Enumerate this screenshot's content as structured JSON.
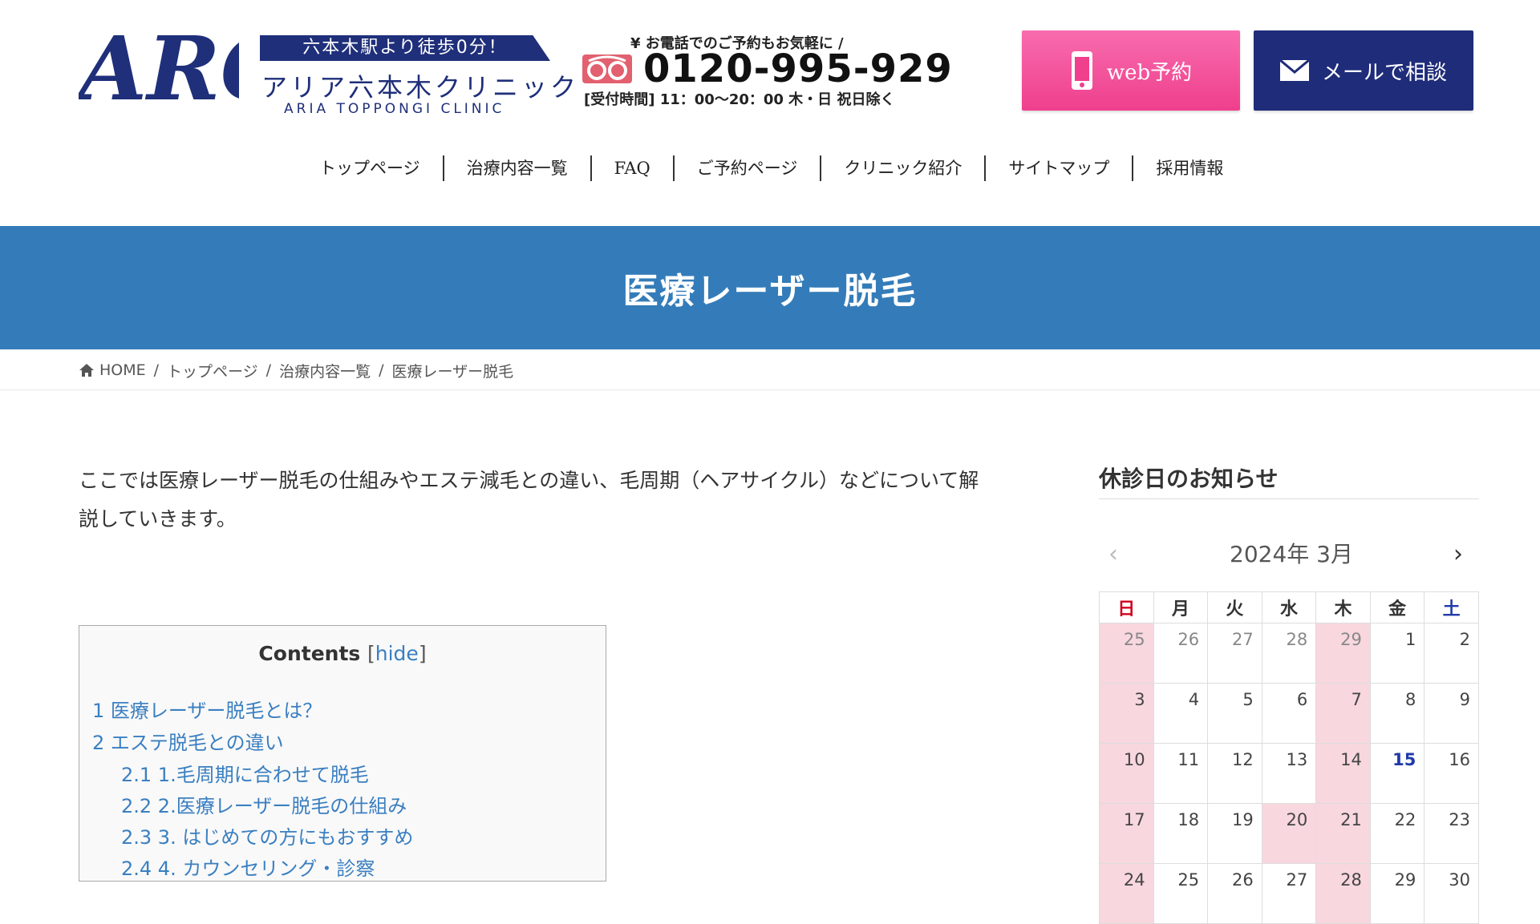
{
  "header": {
    "logo_text": "ARC",
    "badge": "六本木駅より徒歩0分！",
    "clinic_name": "アリア六本木クリニック",
    "clinic_name_en": "ARIA TOPPONGI CLINIC",
    "tel_lead": "¥ お電話でのご予約もお気軽に /",
    "tel_number": "0120-995-929",
    "tel_hours": "[受付時間] 11：00〜20：00 木・日 祝日除く",
    "web_button": "web予約",
    "mail_button": "メールで相談",
    "colors": {
      "web": "#ef3f8d",
      "mail": "#1f2c7a",
      "brand": "#1f2f7a"
    }
  },
  "nav": {
    "items": [
      "トップページ",
      "治療内容一覧",
      "FAQ",
      "ご予約ページ",
      "クリニック紹介",
      "サイトマップ",
      "採用情報"
    ]
  },
  "hero": {
    "title": "医療レーザー脱毛",
    "color": "#347cb9"
  },
  "breadcrumb": {
    "home": "HOME",
    "items": [
      "トップページ",
      "治療内容一覧",
      "医療レーザー脱毛"
    ],
    "sep": "/"
  },
  "main": {
    "intro_line1": "ここでは医療レーザー脱毛の仕組みやエステ減毛との違い、毛周期（ヘアサイクル）などについて解",
    "intro_line2": "説していきます。",
    "toc": {
      "title": "Contents",
      "hide_open": "[",
      "hide_label": "hide",
      "hide_close": "]",
      "items": [
        "1 医療レーザー脱毛とは？",
        "2 エステ脱毛との違い",
        "2.1 1.毛周期に合わせて脱毛",
        "2.2 2.医療レーザー脱毛の仕組み",
        "2.3 3. はじめての方にもおすすめ",
        "2.4 4. カウンセリング・診察"
      ]
    }
  },
  "sidebar": {
    "title": "休診日のお知らせ",
    "calendar": {
      "month_label": "2024年 3月",
      "prev": "‹",
      "next": "›",
      "weekdays": [
        "日",
        "月",
        "火",
        "水",
        "木",
        "金",
        "土"
      ],
      "rows": [
        [
          "25",
          "26",
          "27",
          "28",
          "29",
          "1",
          "2"
        ],
        [
          "3",
          "4",
          "5",
          "6",
          "7",
          "8",
          "9"
        ],
        [
          "10",
          "11",
          "12",
          "13",
          "14",
          "15",
          "16"
        ],
        [
          "17",
          "18",
          "19",
          "20",
          "21",
          "22",
          "23"
        ],
        [
          "24",
          "25",
          "26",
          "27",
          "28",
          "29",
          "30"
        ]
      ],
      "today": "15",
      "holiday_color": "#f8d7df"
    }
  }
}
